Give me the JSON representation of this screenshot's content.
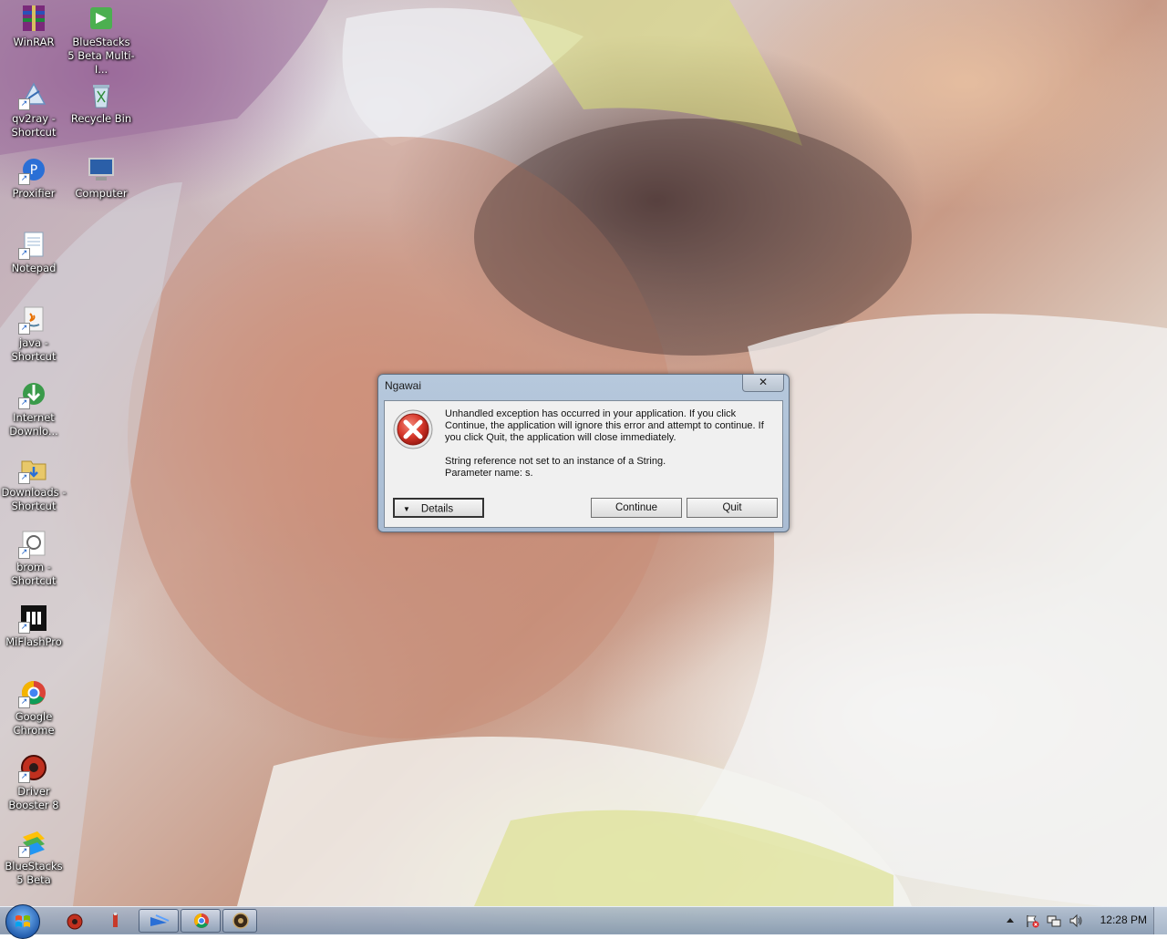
{
  "desktop": {
    "icons": [
      {
        "label": "WinRAR",
        "icon": "winrar-icon"
      },
      {
        "label": "BlueStacks 5 Beta Multi-I...",
        "icon": "bluestacks-multi-instance-icon"
      },
      {
        "label": "qv2ray - Shortcut",
        "icon": "qv2ray-icon"
      },
      {
        "label": "Recycle Bin",
        "icon": "recycle-bin-icon"
      },
      {
        "label": "Proxifier",
        "icon": "proxifier-icon"
      },
      {
        "label": "Computer",
        "icon": "computer-icon"
      },
      {
        "label": "Notepad",
        "icon": "notepad-icon"
      },
      {
        "label": "java - Shortcut",
        "icon": "java-icon"
      },
      {
        "label": "Internet Downlo...",
        "icon": "internet-download-manager-icon"
      },
      {
        "label": "Downloads - Shortcut",
        "icon": "downloads-folder-icon"
      },
      {
        "label": "brom - Shortcut",
        "icon": "brom-icon"
      },
      {
        "label": "MiFlashPro",
        "icon": "miflashpro-icon"
      },
      {
        "label": "Google Chrome",
        "icon": "chrome-icon"
      },
      {
        "label": "Driver Booster 8",
        "icon": "driver-booster-icon"
      },
      {
        "label": "BlueStacks 5 Beta",
        "icon": "bluestacks-icon"
      }
    ]
  },
  "dialog": {
    "title": "Ngawai",
    "close_label": "✕",
    "message": "Unhandled exception has occurred in your application. If you click Continue, the application will ignore this error and attempt to continue. If you click Quit, the application will close immediately.",
    "detail_line1": "String reference not set to an instance of a String.",
    "detail_line2": "Parameter name: s.",
    "details_label": "Details",
    "continue_label": "Continue",
    "quit_label": "Quit",
    "icon": "error-icon"
  },
  "taskbar": {
    "clock": "12:28 PM",
    "start_icon": "windows-start-icon",
    "pinned": [
      "driver-booster-taskbar-icon",
      "usb-taskbar-icon",
      "bluestacks-taskbar-icon",
      "chrome-taskbar-icon",
      "media-taskbar-icon"
    ],
    "tray": [
      "show-hidden-icons-icon",
      "action-center-flag-icon",
      "network-icon",
      "volume-icon"
    ]
  }
}
